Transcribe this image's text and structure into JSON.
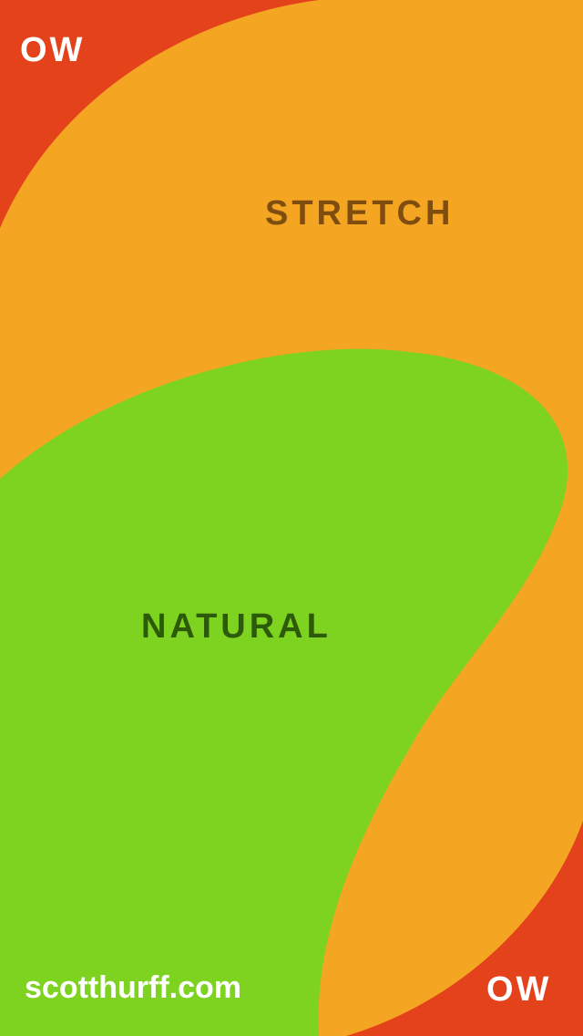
{
  "colors": {
    "background_red": "#e4421b",
    "orange": "#f4a623",
    "green": "#7ed321",
    "stretch_text": "#7f4d0e",
    "natural_text": "#2d5a09",
    "white_text": "#ffffff"
  },
  "labels": {
    "logo_top": "OW",
    "stretch": "STRETCH",
    "natural": "NATURAL",
    "website": "scotthurff.com",
    "logo_bottom": "OW"
  }
}
